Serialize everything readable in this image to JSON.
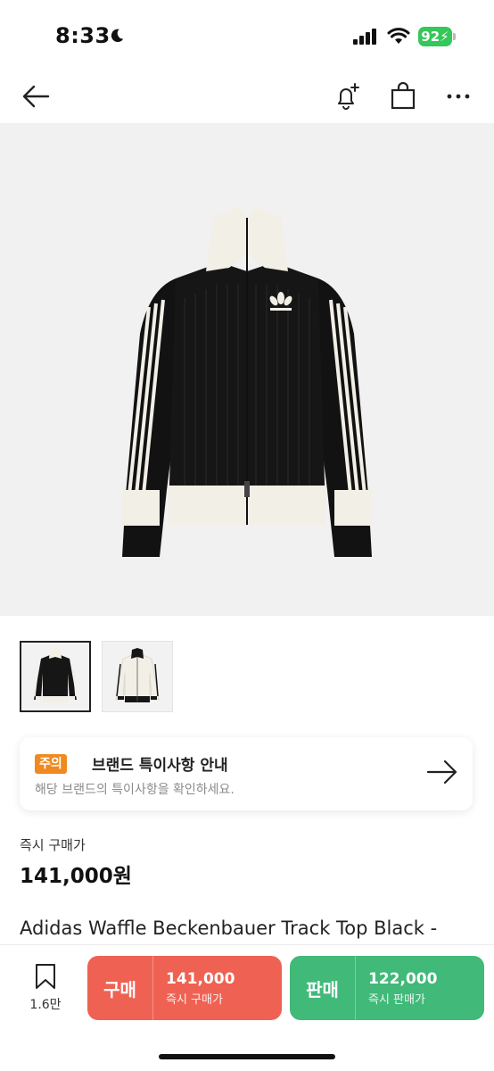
{
  "status_bar": {
    "time": "8:33",
    "battery": "92"
  },
  "nav": {
    "icons": [
      "back-arrow-icon",
      "bell-plus-icon",
      "shopping-bag-icon",
      "more-icon"
    ]
  },
  "thumbnails": [
    "jacket-black",
    "jacket-white"
  ],
  "notice": {
    "badge": "주의",
    "title": "브랜드 특이사항 안내",
    "description": "해당 브랜드의 특이사항을 확인하세요."
  },
  "price": {
    "label": "즉시 구매가",
    "value": "141,000원"
  },
  "product": {
    "name": "Adidas Waffle Beckenbauer Track Top Black -"
  },
  "bottom": {
    "wish_count": "1.6만",
    "buy": {
      "label": "구매",
      "price": "141,000",
      "sub": "즉시 구매가"
    },
    "sell": {
      "label": "판매",
      "price": "122,000",
      "sub": "즉시 판매가"
    }
  },
  "colors": {
    "buy": "#ef6253",
    "sell": "#41b979",
    "notice_badge": "#f0891f",
    "battery": "#34c759"
  }
}
